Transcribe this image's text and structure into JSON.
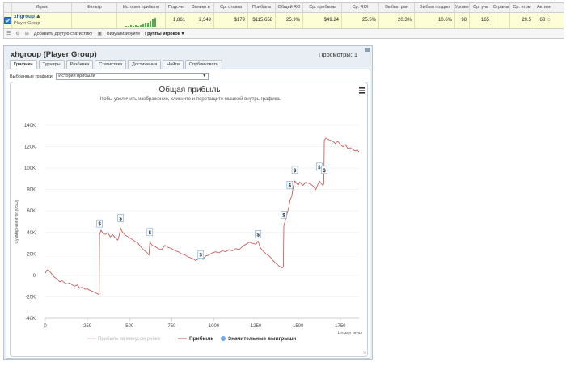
{
  "top_table": {
    "headers": [
      "",
      "Игрок",
      "Фильтр",
      "История прибыли",
      "Подсчет",
      "Заявки и",
      "Ср. ставка",
      "Прибыль",
      "Общий RO",
      "Ср. прибыль",
      "Ср. ROI",
      "Выбыл ран",
      "Выбыл поздно",
      "Уровень",
      "Ср. уча",
      "Страны",
      "Ср. игры",
      "Активн"
    ],
    "row": {
      "player_name": "xhgroup",
      "player_sub": "Player Group",
      "filter": "",
      "count": "1,861",
      "entries": "2,349",
      "avg_stake": "$179",
      "profit": "$115,658",
      "total_roi": "25.9%",
      "avg_profit": "$49.24",
      "avg_roi": "25.5%",
      "early_out": "20.3%",
      "late_out": "10.6%",
      "level": "98",
      "avg_players": "165",
      "countries": "",
      "avg_games": "29.5",
      "active": "63"
    },
    "toolbar": {
      "add_stats": "Добавить другую статистику",
      "visualize": "Визуализируйте",
      "player_groups": "Группы игроков ▾"
    }
  },
  "window": {
    "title": "xhgroup (Player Group)",
    "views": "Просмотры: 1",
    "tabs": [
      "Графики",
      "Турниры",
      "Разбивка",
      "Статистика",
      "Достижения",
      "Найти",
      "Опубликовать"
    ],
    "graph_select_label": "Выбранные графики:",
    "graph_select_value": "История прибыли"
  },
  "chart_data": {
    "type": "line",
    "title": "Общая прибыль",
    "subtitle": "Чтобы увеличить изображение, кликните и перетащите мышкой внутрь графика.",
    "ylabel": "Суммарный итог (USD)",
    "xlabel": "Номер игры",
    "xlim": [
      0,
      1861
    ],
    "ylim": [
      -40000,
      140000
    ],
    "x_ticks": [
      "0",
      "250",
      "500",
      "750",
      "1000",
      "1250",
      "1500",
      "1750"
    ],
    "y_ticks": [
      "-40K",
      "-20K",
      "0",
      "20K",
      "40K",
      "60K",
      "80K",
      "100K",
      "120K",
      "140K"
    ],
    "legend": [
      "Прибыль за минусом рейка",
      "Прибыль",
      "Значительные выигрыши"
    ],
    "legend_colors": [
      "#e8c4c4",
      "#c0504d",
      "#6fa8dc"
    ],
    "profit_series": [
      [
        0,
        2000
      ],
      [
        10,
        5000
      ],
      [
        25,
        4000
      ],
      [
        40,
        1000
      ],
      [
        55,
        -2000
      ],
      [
        70,
        -3000
      ],
      [
        85,
        -6000
      ],
      [
        100,
        -5000
      ],
      [
        115,
        -7000
      ],
      [
        130,
        -8000
      ],
      [
        145,
        -7000
      ],
      [
        160,
        -9000
      ],
      [
        175,
        -10000
      ],
      [
        190,
        -9000
      ],
      [
        205,
        -12000
      ],
      [
        220,
        -11000
      ],
      [
        235,
        -13000
      ],
      [
        250,
        -12500
      ],
      [
        265,
        -14000
      ],
      [
        280,
        -15000
      ],
      [
        295,
        -16000
      ],
      [
        308,
        -17000
      ],
      [
        320,
        -18000
      ],
      [
        322,
        38000
      ],
      [
        330,
        42000
      ],
      [
        340,
        40000
      ],
      [
        355,
        38000
      ],
      [
        370,
        40000
      ],
      [
        385,
        36000
      ],
      [
        400,
        38000
      ],
      [
        415,
        35000
      ],
      [
        430,
        33000
      ],
      [
        440,
        38000
      ],
      [
        447,
        44000
      ],
      [
        455,
        41000
      ],
      [
        470,
        38000
      ],
      [
        490,
        36000
      ],
      [
        510,
        34000
      ],
      [
        530,
        32000
      ],
      [
        550,
        30000
      ],
      [
        570,
        26000
      ],
      [
        590,
        23000
      ],
      [
        605,
        21000
      ],
      [
        615,
        19000
      ],
      [
        620,
        31000
      ],
      [
        635,
        28000
      ],
      [
        650,
        27000
      ],
      [
        670,
        25000
      ],
      [
        690,
        24000
      ],
      [
        710,
        28000
      ],
      [
        730,
        26000
      ],
      [
        750,
        25000
      ],
      [
        770,
        23000
      ],
      [
        790,
        22000
      ],
      [
        810,
        20000
      ],
      [
        830,
        19000
      ],
      [
        850,
        17000
      ],
      [
        870,
        16000
      ],
      [
        890,
        14000
      ],
      [
        905,
        15000
      ],
      [
        920,
        17000
      ],
      [
        935,
        15000
      ],
      [
        950,
        18000
      ],
      [
        970,
        19000
      ],
      [
        990,
        21000
      ],
      [
        1010,
        22000
      ],
      [
        1030,
        21000
      ],
      [
        1050,
        23000
      ],
      [
        1070,
        22000
      ],
      [
        1090,
        24000
      ],
      [
        1110,
        23000
      ],
      [
        1130,
        25000
      ],
      [
        1150,
        24000
      ],
      [
        1170,
        27000
      ],
      [
        1190,
        29000
      ],
      [
        1210,
        31000
      ],
      [
        1230,
        30000
      ],
      [
        1250,
        29000
      ],
      [
        1262,
        32000
      ],
      [
        1275,
        26000
      ],
      [
        1290,
        23000
      ],
      [
        1310,
        20000
      ],
      [
        1330,
        18000
      ],
      [
        1350,
        14000
      ],
      [
        1370,
        11000
      ],
      [
        1385,
        9000
      ],
      [
        1395,
        8000
      ],
      [
        1405,
        7000
      ],
      [
        1412,
        8000
      ],
      [
        1415,
        46000
      ],
      [
        1425,
        52000
      ],
      [
        1435,
        58000
      ],
      [
        1445,
        64000
      ],
      [
        1452,
        70000
      ],
      [
        1462,
        74000
      ],
      [
        1470,
        82000
      ],
      [
        1480,
        88000
      ],
      [
        1490,
        86000
      ],
      [
        1500,
        84000
      ],
      [
        1510,
        87000
      ],
      [
        1520,
        85000
      ],
      [
        1530,
        84000
      ],
      [
        1545,
        87000
      ],
      [
        1560,
        86000
      ],
      [
        1575,
        85000
      ],
      [
        1590,
        83000
      ],
      [
        1605,
        80000
      ],
      [
        1615,
        84000
      ],
      [
        1625,
        88000
      ],
      [
        1635,
        86000
      ],
      [
        1645,
        84000
      ],
      [
        1652,
        85000
      ],
      [
        1655,
        126000
      ],
      [
        1665,
        128000
      ],
      [
        1675,
        127000
      ],
      [
        1690,
        126000
      ],
      [
        1705,
        125000
      ],
      [
        1720,
        123000
      ],
      [
        1735,
        125000
      ],
      [
        1750,
        122000
      ],
      [
        1765,
        120000
      ],
      [
        1780,
        122000
      ],
      [
        1795,
        118000
      ],
      [
        1810,
        119000
      ],
      [
        1825,
        117000
      ],
      [
        1840,
        116000
      ],
      [
        1850,
        117000
      ],
      [
        1861,
        115000
      ]
    ],
    "big_wins": [
      {
        "x": 322,
        "y": 48000,
        "label": "$"
      },
      {
        "x": 447,
        "y": 53000,
        "label": "$"
      },
      {
        "x": 620,
        "y": 40000,
        "label": "$"
      },
      {
        "x": 922,
        "y": 19000,
        "label": "$"
      },
      {
        "x": 1262,
        "y": 38000,
        "label": "$"
      },
      {
        "x": 1415,
        "y": 56000,
        "label": "$"
      },
      {
        "x": 1450,
        "y": 84000,
        "label": "$"
      },
      {
        "x": 1480,
        "y": 98000,
        "label": "$"
      },
      {
        "x": 1625,
        "y": 101000,
        "label": "$"
      },
      {
        "x": 1655,
        "y": 98000,
        "label": "$"
      }
    ]
  }
}
